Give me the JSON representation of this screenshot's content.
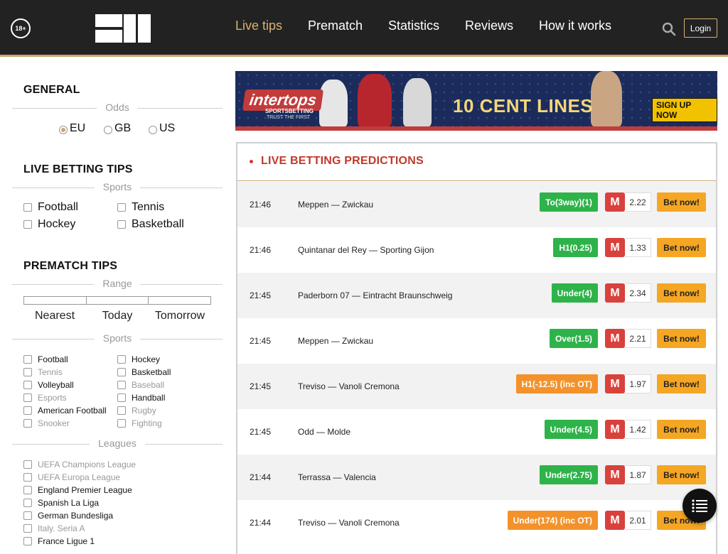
{
  "header": {
    "age_badge": "18+",
    "nav": [
      {
        "label": "Live tips",
        "active": true
      },
      {
        "label": "Prematch",
        "active": false
      },
      {
        "label": "Statistics",
        "active": false
      },
      {
        "label": "Reviews",
        "active": false
      },
      {
        "label": "How it works",
        "active": false
      }
    ],
    "search_icon": "search-icon",
    "login_label": "Login",
    "accent_color": "#d9b26f"
  },
  "sidebar": {
    "general": {
      "title": "GENERAL",
      "odds_label": "Odds",
      "odds_options": [
        "EU",
        "GB",
        "US"
      ],
      "odds_selected": "EU"
    },
    "live": {
      "title": "LIVE BETTING TIPS",
      "sports_label": "Sports",
      "sports": [
        "Football",
        "Tennis",
        "Hockey",
        "Basketball"
      ]
    },
    "prematch": {
      "title": "PREMATCH TIPS",
      "range_label": "Range",
      "range_options": [
        "Nearest",
        "Today",
        "Tomorrow"
      ],
      "sports_label": "Sports",
      "sports": [
        "Football",
        "Hockey",
        "Tennis",
        "Basketball",
        "Volleyball",
        "Baseball",
        "Esports",
        "Handball",
        "American Football",
        "Rugby",
        "Snooker",
        "Fighting"
      ],
      "leagues_label": "Leagues",
      "leagues": [
        "UEFA Champions League",
        "UEFA Europa League",
        "England Premier League",
        "Spanish La Liga",
        "German Bundesliga",
        "Italy. Seria A",
        "France Ligue 1"
      ]
    }
  },
  "banner": {
    "brand": "intertops",
    "brand_sub": "SPORTSBETTING",
    "brand_tag": "TRUST THE FIRST",
    "headline": "10 CENT LINES",
    "cta": "SIGN UP NOW"
  },
  "predictions": {
    "title": "LIVE BETTING PREDICTIONS",
    "bet_label": "Bet now!",
    "bookmaker_mark": "M",
    "rows": [
      {
        "time": "21:46",
        "match": "Meppen — Zwickau",
        "tip": "To(3way)(1)",
        "tip_color": "green",
        "odds": "2.22"
      },
      {
        "time": "21:46",
        "match": "Quintanar del Rey — Sporting Gijon",
        "tip": "H1(0.25)",
        "tip_color": "green",
        "odds": "1.33"
      },
      {
        "time": "21:45",
        "match": "Paderborn 07 — Eintracht Braunschweig",
        "tip": "Under(4)",
        "tip_color": "green",
        "odds": "2.34"
      },
      {
        "time": "21:45",
        "match": "Meppen — Zwickau",
        "tip": "Over(1.5)",
        "tip_color": "green",
        "odds": "2.21"
      },
      {
        "time": "21:45",
        "match": "Treviso — Vanoli Cremona",
        "tip": "H1(-12.5) (inc OT)",
        "tip_color": "orange",
        "odds": "1.97"
      },
      {
        "time": "21:45",
        "match": "Odd — Molde",
        "tip": "Under(4.5)",
        "tip_color": "green",
        "odds": "1.42"
      },
      {
        "time": "21:44",
        "match": "Terrassa — Valencia",
        "tip": "Under(2.75)",
        "tip_color": "green",
        "odds": "1.87"
      },
      {
        "time": "21:44",
        "match": "Treviso — Vanoli Cremona",
        "tip": "Under(174) (inc OT)",
        "tip_color": "orange",
        "odds": "2.01"
      }
    ]
  },
  "fab_icon": "list-icon"
}
